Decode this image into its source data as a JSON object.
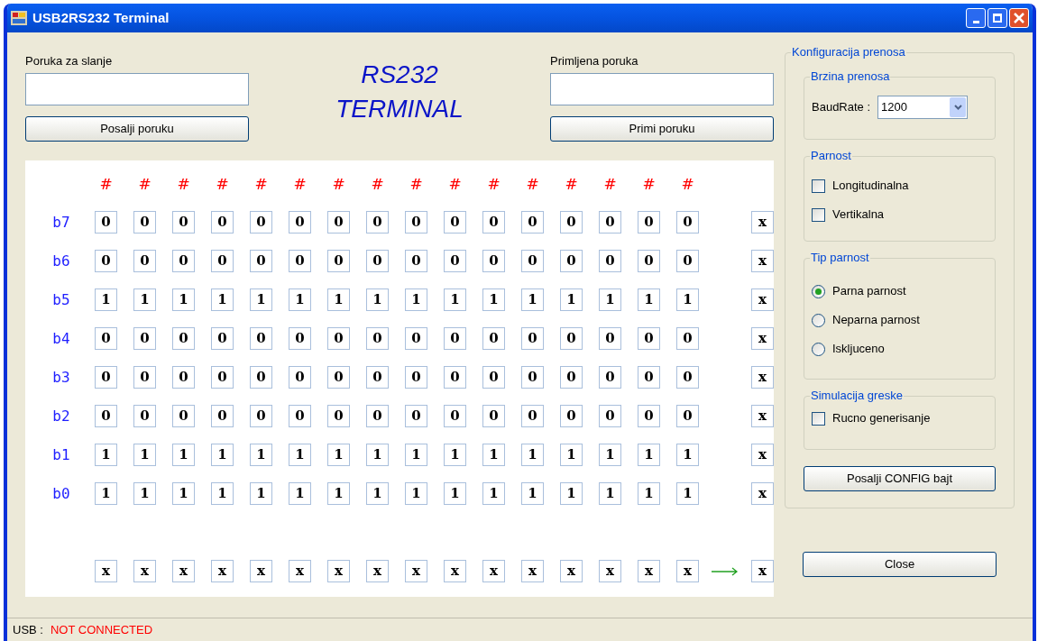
{
  "window": {
    "title": "USB2RS232 Terminal"
  },
  "send": {
    "label": "Poruka za slanje",
    "button": "Posalji poruku"
  },
  "banner": [
    "RS232",
    "TERMINAL"
  ],
  "receive": {
    "label": "Primljena poruka",
    "button": "Primi poruku"
  },
  "grid": {
    "headers": [
      "#",
      "#",
      "#",
      "#",
      "#",
      "#",
      "#",
      "#",
      "#",
      "#",
      "#",
      "#",
      "#",
      "#",
      "#",
      "#"
    ],
    "rows": [
      {
        "label": "b7",
        "bits": [
          "0",
          "0",
          "0",
          "0",
          "0",
          "0",
          "0",
          "0",
          "0",
          "0",
          "0",
          "0",
          "0",
          "0",
          "0",
          "0"
        ],
        "parity": "x"
      },
      {
        "label": "b6",
        "bits": [
          "0",
          "0",
          "0",
          "0",
          "0",
          "0",
          "0",
          "0",
          "0",
          "0",
          "0",
          "0",
          "0",
          "0",
          "0",
          "0"
        ],
        "parity": "x"
      },
      {
        "label": "b5",
        "bits": [
          "1",
          "1",
          "1",
          "1",
          "1",
          "1",
          "1",
          "1",
          "1",
          "1",
          "1",
          "1",
          "1",
          "1",
          "1",
          "1"
        ],
        "parity": "x"
      },
      {
        "label": "b4",
        "bits": [
          "0",
          "0",
          "0",
          "0",
          "0",
          "0",
          "0",
          "0",
          "0",
          "0",
          "0",
          "0",
          "0",
          "0",
          "0",
          "0"
        ],
        "parity": "x"
      },
      {
        "label": "b3",
        "bits": [
          "0",
          "0",
          "0",
          "0",
          "0",
          "0",
          "0",
          "0",
          "0",
          "0",
          "0",
          "0",
          "0",
          "0",
          "0",
          "0"
        ],
        "parity": "x"
      },
      {
        "label": "b2",
        "bits": [
          "0",
          "0",
          "0",
          "0",
          "0",
          "0",
          "0",
          "0",
          "0",
          "0",
          "0",
          "0",
          "0",
          "0",
          "0",
          "0"
        ],
        "parity": "x"
      },
      {
        "label": "b1",
        "bits": [
          "1",
          "1",
          "1",
          "1",
          "1",
          "1",
          "1",
          "1",
          "1",
          "1",
          "1",
          "1",
          "1",
          "1",
          "1",
          "1"
        ],
        "parity": "x"
      },
      {
        "label": "b0",
        "bits": [
          "1",
          "1",
          "1",
          "1",
          "1",
          "1",
          "1",
          "1",
          "1",
          "1",
          "1",
          "1",
          "1",
          "1",
          "1",
          "1"
        ],
        "parity": "x"
      }
    ],
    "bottom": [
      "x",
      "x",
      "x",
      "x",
      "x",
      "x",
      "x",
      "x",
      "x",
      "x",
      "x",
      "x",
      "x",
      "x",
      "x",
      "x"
    ],
    "bottom_result": "x"
  },
  "config": {
    "title": "Konfiguracija prenosa",
    "speed": {
      "title": "Brzina prenosa",
      "label": "BaudRate :",
      "value": "1200"
    },
    "parity": {
      "title": "Parnost",
      "options": [
        {
          "label": "Longitudinalna",
          "checked": false
        },
        {
          "label": "Vertikalna",
          "checked": false
        }
      ]
    },
    "parity_type": {
      "title": "Tip parnost",
      "options": [
        {
          "label": "Parna parnost",
          "selected": true
        },
        {
          "label": "Neparna parnost",
          "selected": false
        },
        {
          "label": "Iskljuceno",
          "selected": false
        }
      ]
    },
    "error_sim": {
      "title": "Simulacija greske",
      "options": [
        {
          "label": "Rucno generisanje",
          "checked": false
        }
      ]
    },
    "button": "Posalji CONFIG bajt"
  },
  "close_button": "Close",
  "status_bar": {
    "label": "USB :",
    "value": "NOT CONNECTED"
  }
}
